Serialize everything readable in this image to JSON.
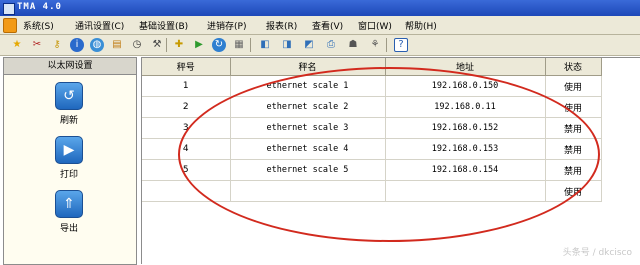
{
  "window": {
    "title": "TMA 4.0"
  },
  "menu": {
    "items": [
      "系统(S)",
      "通讯设置(C)",
      "基础设置(B)",
      "进销存(P)",
      "报表(R)",
      "查看(V)",
      "窗口(W)",
      "帮助(H)"
    ]
  },
  "toolbar": {
    "icons": [
      "star-icon",
      "scissors-icon",
      "key-icon",
      "info-icon",
      "globe-icon",
      "document-icon",
      "clock-icon",
      "tools-icon",
      "add-icon",
      "play-icon",
      "refresh-icon",
      "database-icon",
      "scale-icon",
      "export-icon",
      "import-icon",
      "print-icon",
      "users-icon",
      "tree-icon",
      "help-icon"
    ]
  },
  "sidebar": {
    "header": "以太网设置",
    "buttons": [
      {
        "label": "刷新",
        "icon": "refresh-icon"
      },
      {
        "label": "打印",
        "icon": "camera-icon"
      },
      {
        "label": "导出",
        "icon": "export-up-icon"
      }
    ]
  },
  "table": {
    "columns": [
      "秤号",
      "秤名",
      "地址",
      "状态"
    ],
    "rows": [
      {
        "num": "1",
        "name": "ethernet scale 1",
        "addr": "192.168.0.150",
        "status": "使用"
      },
      {
        "num": "2",
        "name": "ethernet scale 2",
        "addr": "192.168.0.11",
        "status": "使用"
      },
      {
        "num": "3",
        "name": "ethernet scale 3",
        "addr": "192.168.0.152",
        "status": "禁用"
      },
      {
        "num": "4",
        "name": "ethernet scale 4",
        "addr": "192.168.0.153",
        "status": "禁用"
      },
      {
        "num": "5",
        "name": "ethernet scale 5",
        "addr": "192.168.0.154",
        "status": "禁用"
      },
      {
        "num": "",
        "name": "",
        "addr": "",
        "status": "使用"
      }
    ]
  },
  "watermark": "头条号 / dkcisco",
  "colors": {
    "annotation": "#d22a1e",
    "titlebar": "#1d48b8",
    "chrome": "#ece9d8"
  }
}
